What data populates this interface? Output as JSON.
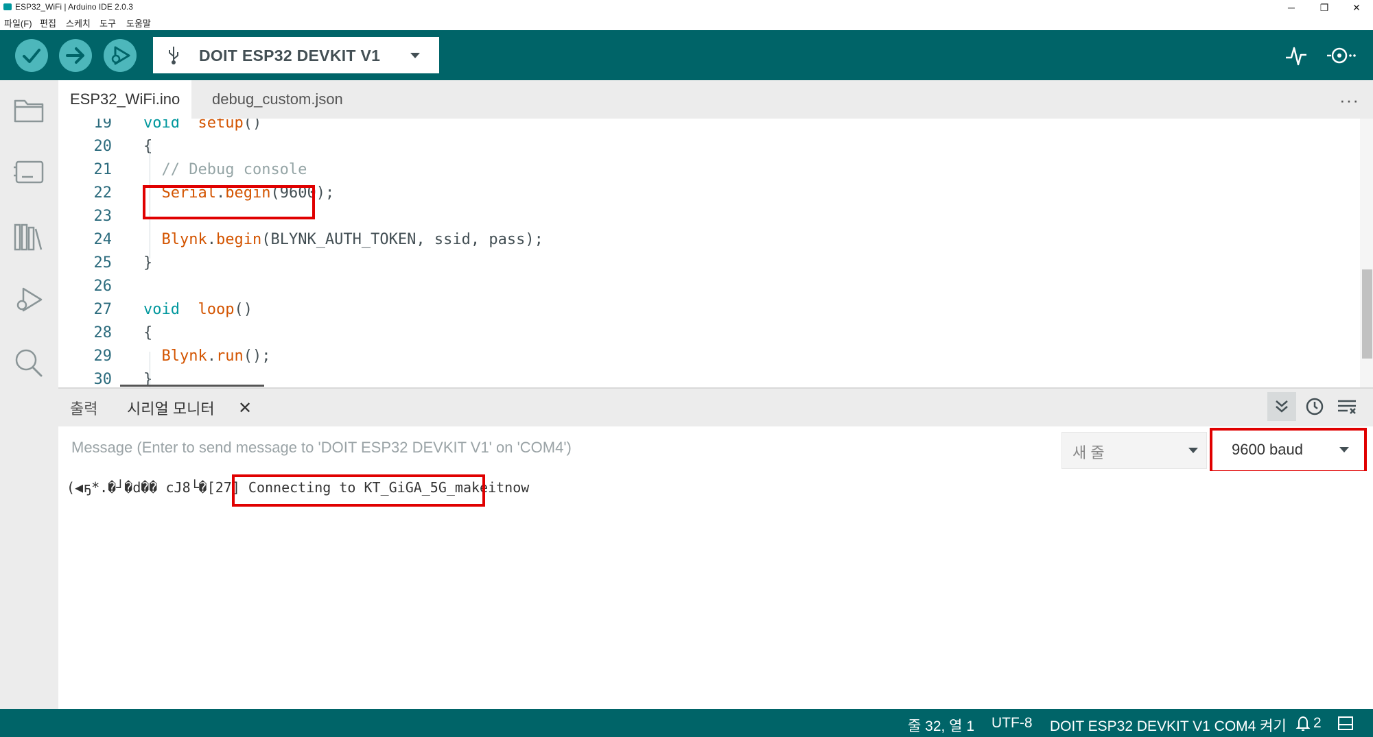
{
  "window": {
    "title": "ESP32_WiFi | Arduino IDE 2.0.3",
    "controls": [
      "─",
      "❐",
      "✕"
    ]
  },
  "menu": {
    "items": [
      "파일(F)",
      "편집",
      "스케치",
      "도구",
      "도움말"
    ]
  },
  "toolbar": {
    "verify_icon": "checkmark-icon",
    "upload_icon": "arrow-right-icon",
    "debug_icon": "debug-play-icon",
    "board_name": "DOIT ESP32 DEVKIT V1",
    "serial_plotter_icon": "pulse-icon",
    "serial_monitor_icon": "serial-monitor-icon"
  },
  "sidebar": {
    "items": [
      "folder-icon",
      "board-icon",
      "library-icon",
      "debug-icon",
      "search-icon"
    ]
  },
  "tabs": {
    "items": [
      {
        "label": "ESP32_WiFi.ino",
        "active": true
      },
      {
        "label": "debug_custom.json",
        "active": false
      }
    ],
    "more": "···"
  },
  "editor": {
    "lines": [
      {
        "num": "19",
        "tokens": [
          [
            "kw",
            "void"
          ],
          [
            "",
            "  "
          ],
          [
            "fn",
            "setup"
          ],
          [
            "",
            "()"
          ]
        ]
      },
      {
        "num": "20",
        "tokens": [
          [
            "",
            "{"
          ]
        ]
      },
      {
        "num": "21",
        "tokens": [
          [
            "",
            "  "
          ],
          [
            "cm",
            "// Debug console"
          ]
        ]
      },
      {
        "num": "22",
        "tokens": [
          [
            "",
            "  "
          ],
          [
            "fn",
            "Serial"
          ],
          [
            "",
            "."
          ],
          [
            "fn",
            "begin"
          ],
          [
            "",
            "(9600);"
          ]
        ]
      },
      {
        "num": "23",
        "tokens": []
      },
      {
        "num": "24",
        "tokens": [
          [
            "",
            "  "
          ],
          [
            "fn",
            "Blynk"
          ],
          [
            "",
            "."
          ],
          [
            "fn",
            "begin"
          ],
          [
            "",
            "(BLYNK_AUTH_TOKEN, ssid, pass);"
          ]
        ]
      },
      {
        "num": "25",
        "tokens": [
          [
            "",
            "}"
          ]
        ]
      },
      {
        "num": "26",
        "tokens": []
      },
      {
        "num": "27",
        "tokens": [
          [
            "kw",
            "void"
          ],
          [
            "",
            "  "
          ],
          [
            "fn",
            "loop"
          ],
          [
            "",
            "()"
          ]
        ]
      },
      {
        "num": "28",
        "tokens": [
          [
            "",
            "{"
          ]
        ]
      },
      {
        "num": "29",
        "tokens": [
          [
            "",
            "  "
          ],
          [
            "fn",
            "Blynk"
          ],
          [
            "",
            "."
          ],
          [
            "fn",
            "run"
          ],
          [
            "",
            "();"
          ]
        ]
      },
      {
        "num": "30",
        "tokens": [
          [
            "",
            "}"
          ]
        ]
      }
    ]
  },
  "panel": {
    "tabs": [
      "출력",
      "시리얼 모니터"
    ],
    "close": "✕",
    "message_placeholder": "Message (Enter to send message to 'DOIT ESP32 DEVKIT V1' on 'COM4')",
    "line_ending": "새 줄",
    "baud": "9600 baud",
    "serial_garbage": "(◀ҕ*.�┘�d�� cJ8└�",
    "serial_message": "[27] Connecting to KT_GiGA_5G_makeitnow"
  },
  "statusbar": {
    "position": "줄 32, 열 1",
    "encoding": "UTF-8",
    "board_port": "DOIT ESP32 DEVKIT V1 COM4 켜기",
    "notifications": "2"
  },
  "colors": {
    "teal_dark": "#006468",
    "teal_light": "#4db7bb",
    "highlight_red": "#e00000",
    "keyword": "#00979d",
    "function": "#d35400",
    "comment": "#95a5a6"
  }
}
